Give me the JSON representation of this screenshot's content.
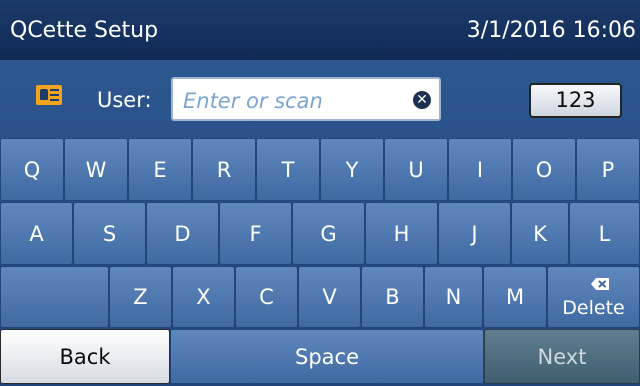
{
  "header": {
    "title": "QCette Setup",
    "datetime": "3/1/2016 16:06"
  },
  "user_row": {
    "label": "User:",
    "input_placeholder": "Enter or scan",
    "numeric_button_label": "123",
    "icon": "id-card-icon",
    "clear_icon": "clear-circle-x-icon"
  },
  "keyboard": {
    "row1": [
      "Q",
      "W",
      "E",
      "R",
      "T",
      "Y",
      "U",
      "I",
      "O",
      "P"
    ],
    "row2": [
      "A",
      "S",
      "D",
      "F",
      "G",
      "H",
      "J",
      "K",
      "L"
    ],
    "row3": [
      "Z",
      "X",
      "C",
      "V",
      "B",
      "N",
      "M"
    ],
    "delete_label": "Delete",
    "delete_icon": "backspace-icon"
  },
  "bottom_row": {
    "back_label": "Back",
    "space_label": "Space",
    "next_label": "Next"
  },
  "colors": {
    "title_bar": "#0f2a55",
    "background": "#2f5a93",
    "key": "#4f79b0",
    "id_card": "#f3a21a",
    "next_button": "#4f6f80"
  }
}
